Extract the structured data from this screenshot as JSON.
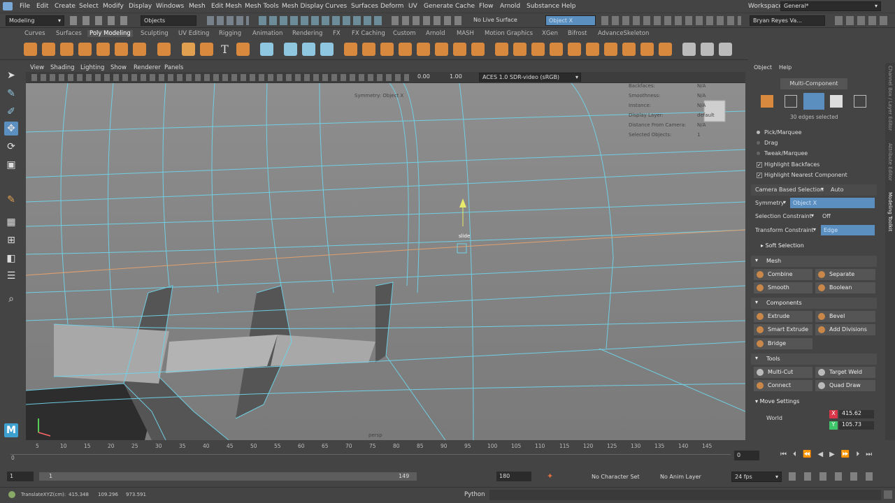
{
  "menubar": {
    "items": [
      "File",
      "Edit",
      "Create",
      "Select",
      "Modify",
      "Display",
      "Windows",
      "Mesh",
      "Edit Mesh",
      "Mesh Tools",
      "Mesh Display",
      "Curves",
      "Surfaces",
      "Deform",
      "UV",
      "Generate",
      "Cache",
      "Flow",
      "Arnold",
      "Substance",
      "Help"
    ],
    "workspace_label": "Workspace :",
    "workspace_value": "General*"
  },
  "statusline": {
    "mode": "Modeling",
    "selection_mask": "Objects",
    "live_surface": "No Live Surface",
    "symmetry_field": "Object X",
    "user": "Bryan Reyes Va..."
  },
  "shelf_tabs": [
    "Curves",
    "Surfaces",
    "Poly Modeling",
    "Sculpting",
    "UV Editing",
    "Rigging",
    "Animation",
    "Rendering",
    "FX",
    "FX Caching",
    "Custom",
    "Arnold",
    "MASH",
    "Motion Graphics",
    "XGen",
    "Bifrost",
    "AdvanceSkeleton"
  ],
  "shelf_active": "Poly Modeling",
  "panel_menu": [
    "View",
    "Shading",
    "Lighting",
    "Show",
    "Renderer",
    "Panels"
  ],
  "panel_toolbar": {
    "exposure": "0.00",
    "gamma": "1.00",
    "color_space": "ACES 1.0 SDR-video (sRGB)"
  },
  "viewport": {
    "symmetry_label": "Symmetry: Object X",
    "manip_label": "slide",
    "camera_label": "persp",
    "hud": [
      {
        "label": "Backfaces:",
        "value": "N/A"
      },
      {
        "label": "Smoothness:",
        "value": "N/A"
      },
      {
        "label": "Instance:",
        "value": "N/A"
      },
      {
        "label": "Display Layer:",
        "value": "default"
      },
      {
        "label": "Distance From Camera:",
        "value": "N/A"
      },
      {
        "label": "Selected Objects:",
        "value": "1"
      }
    ]
  },
  "modeling_toolkit": {
    "menu": [
      "Object",
      "Help"
    ],
    "header": "Multi-Component",
    "selected_info": "30 edges selected",
    "pick_modes": [
      "Pick/Marquee",
      "Drag",
      "Tweak/Marquee"
    ],
    "highlight_backfaces": "Highlight Backfaces",
    "highlight_nearest": "Highlight Nearest Component",
    "camera_based_label": "Camera Based Selection",
    "camera_based_value": "Auto",
    "symmetry_label": "Symmetry",
    "symmetry_value": "Object X",
    "selection_constraint_label": "Selection Constraint",
    "selection_constraint_value": "Off",
    "transform_constraint_label": "Transform Constraint",
    "transform_constraint_value": "Edge",
    "soft_selection": "Soft Selection",
    "mesh_section": "Mesh",
    "mesh_buttons": [
      "Combine",
      "Separate",
      "Smooth",
      "Boolean"
    ],
    "components_section": "Components",
    "component_buttons": [
      "Extrude",
      "Bevel",
      "Smart Extrude",
      "Add Divisions",
      "Bridge"
    ],
    "tools_section": "Tools",
    "tool_buttons": [
      "Multi-Cut",
      "Target Weld",
      "Connect",
      "Quad Draw"
    ],
    "move_settings": "Move Settings",
    "world": "World",
    "x_value": "415.62",
    "y_value": "105.73"
  },
  "side_tabs": [
    "Channel Box / Layer Editor",
    "Attribute Editor",
    "Modeling Toolkit"
  ],
  "timeline": {
    "ticks": [
      "0",
      "5",
      "10",
      "15",
      "20",
      "25",
      "30",
      "35",
      "40",
      "45",
      "50",
      "55",
      "60",
      "65",
      "70",
      "75",
      "80",
      "85",
      "90",
      "95",
      "100",
      "105",
      "110",
      "115",
      "120",
      "125",
      "130",
      "135",
      "140",
      "145"
    ],
    "current_frame": "0"
  },
  "range": {
    "start": "1",
    "inner_start": "1",
    "inner_end": "149",
    "end": "180",
    "character_set": "No Character Set",
    "anim_layer": "No Anim Layer",
    "fps": "24 fps"
  },
  "commandline": {
    "translate_label": "TranslateXYZ(cm):",
    "tx": "415.348",
    "ty": "109.296",
    "tz": "973.591",
    "language": "Python"
  },
  "colors": {
    "wire": "#6fd3e8",
    "accent": "#5a8fc0",
    "orange_edge": "#e0a070"
  }
}
